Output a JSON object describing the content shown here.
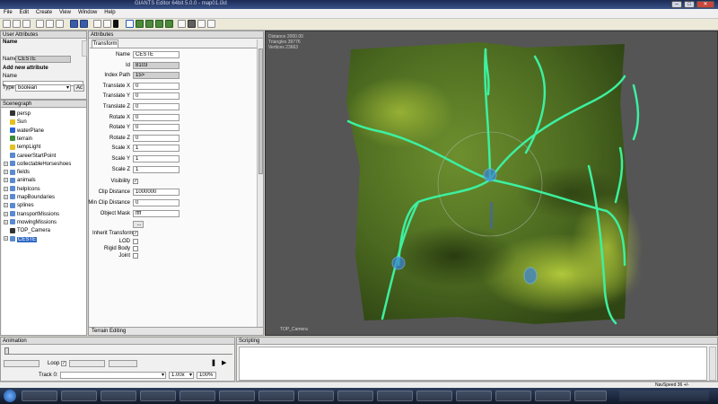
{
  "app": {
    "window_title": "GIANTS Editor 64bit 5.0.0 - map01.i3d"
  },
  "menu": [
    "File",
    "Edit",
    "Create",
    "View",
    "Window",
    "Help"
  ],
  "user_attributes": {
    "title": "User Attributes",
    "name_header": "Name",
    "name_label": "Name",
    "name_value": "CESTE",
    "add_header": "Add new attribute",
    "new_name_label": "Name",
    "type_label": "Type",
    "type_value": "boolean",
    "add_button": "Ac"
  },
  "scenegraph": {
    "title": "Scenegraph",
    "items": [
      {
        "label": "persp",
        "icon": "camera-icon",
        "expandable": false,
        "selected": false
      },
      {
        "label": "Sun",
        "icon": "light-icon",
        "expandable": false,
        "selected": false
      },
      {
        "label": "waterPlane",
        "icon": "shape-icon",
        "expandable": false,
        "selected": false
      },
      {
        "label": "terrain",
        "icon": "terrain-icon",
        "expandable": false,
        "selected": false
      },
      {
        "label": "tempLight",
        "icon": "light-icon",
        "expandable": false,
        "selected": false
      },
      {
        "label": "careerStartPoint",
        "icon": "transform-icon",
        "expandable": false,
        "selected": false
      },
      {
        "label": "collectableHorseshoes",
        "icon": "transform-icon",
        "expandable": true,
        "selected": false
      },
      {
        "label": "fields",
        "icon": "transform-icon",
        "expandable": true,
        "selected": false
      },
      {
        "label": "animals",
        "icon": "transform-icon",
        "expandable": true,
        "selected": false
      },
      {
        "label": "helpIcons",
        "icon": "transform-icon",
        "expandable": true,
        "selected": false
      },
      {
        "label": "mapBoundaries",
        "icon": "transform-icon",
        "expandable": true,
        "selected": false
      },
      {
        "label": "splines",
        "icon": "transform-icon",
        "expandable": true,
        "selected": false
      },
      {
        "label": "transportMissions",
        "icon": "transform-icon",
        "expandable": true,
        "selected": false
      },
      {
        "label": "mowingMissions",
        "icon": "transform-icon",
        "expandable": true,
        "selected": false
      },
      {
        "label": "TOP_Camera",
        "icon": "camera-icon",
        "expandable": false,
        "selected": false
      },
      {
        "label": "CESTE",
        "icon": "transform-icon",
        "expandable": true,
        "selected": true
      }
    ]
  },
  "attributes": {
    "title": "Attributes",
    "tab": "Transform",
    "fields": [
      {
        "label": "Name",
        "value": "CESTE",
        "gray": false
      },
      {
        "label": "Id",
        "value": "8103",
        "gray": true
      },
      {
        "label": "Index Path",
        "value": "15>",
        "gray": true
      },
      {
        "label": "Translate X",
        "value": "0",
        "gray": false
      },
      {
        "label": "Translate Y",
        "value": "0",
        "gray": false
      },
      {
        "label": "Translate Z",
        "value": "0",
        "gray": false
      },
      {
        "label": "Rotate X",
        "value": "0",
        "gray": false
      },
      {
        "label": "Rotate Y",
        "value": "0",
        "gray": false
      },
      {
        "label": "Rotate Z",
        "value": "0",
        "gray": false
      },
      {
        "label": "Scale X",
        "value": "1",
        "gray": false
      },
      {
        "label": "Scale Y",
        "value": "1",
        "gray": false
      },
      {
        "label": "Scale Z",
        "value": "1",
        "gray": false
      }
    ],
    "visibility_label": "Visibility",
    "visibility_checked": true,
    "clip_label": "Clip Distance",
    "clip_value": "1000000",
    "min_clip_label": "Min Clip Distance",
    "min_clip_value": "0",
    "mask_label": "Object Mask",
    "mask_value": "ffff",
    "mask_button": "...",
    "inherit_label": "Inherit Transform",
    "lod_label": "LOD",
    "rigid_label": "Rigid Body",
    "joint_label": "Joint",
    "terrain_tab": "Terrain Editing"
  },
  "viewport": {
    "stats": [
      "Distance 2000.00",
      "Triangles 39776",
      "Vertices 23663"
    ],
    "camera_label": "TOP_Camera"
  },
  "animation": {
    "title": "Animation",
    "loop_label": "Loop",
    "loop_checked": true,
    "track_label": "Track 0:",
    "speed_value": "1.00x",
    "percent_value": "100%"
  },
  "scripting": {
    "title": "Scripting"
  },
  "status": {
    "nav_speed": "NavSpeed 36 +/-"
  },
  "colors": {
    "road": "#3cf0a0",
    "terrain": "#5a7a28",
    "selection": "#3169c6"
  }
}
